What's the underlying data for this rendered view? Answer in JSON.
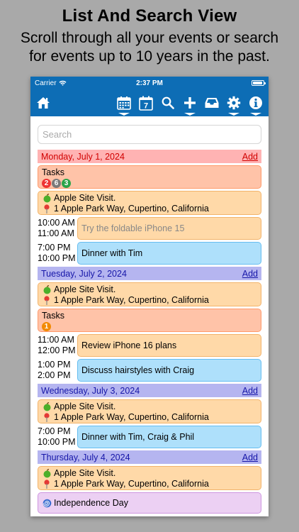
{
  "promo": {
    "title": "List And Search View",
    "subtitle_line1": "Scroll through all your events or search",
    "subtitle_line2": "for events up to 10 years in the past."
  },
  "statusbar": {
    "carrier": "Carrier",
    "time": "2:37 PM"
  },
  "toolbar": {
    "icons": [
      "home-icon",
      "calendar-month-icon",
      "calendar-week-icon",
      "search-icon",
      "add-event-icon",
      "inbox-icon",
      "settings-icon",
      "info-icon"
    ],
    "week_number": "7",
    "color": "#0d6db5"
  },
  "search": {
    "placeholder": "Search",
    "value": ""
  },
  "days": [
    {
      "header": "Monday, July 1, 2024",
      "add": "Add",
      "tasks_label": "Tasks",
      "badges": [
        "2",
        "6",
        "3"
      ],
      "site_title": "Apple Site Visit.",
      "site_address": "1 Apple Park Way, Cupertino, California",
      "events": [
        {
          "start": "10:00 AM",
          "end": "11:00 AM",
          "title": "Try the foldable iPhone 15"
        },
        {
          "start": "7:00 PM",
          "end": "10:00 PM",
          "title": "Dinner with Tim"
        }
      ]
    },
    {
      "header": "Tuesday, July 2, 2024",
      "add": "Add",
      "site_title": "Apple Site Visit.",
      "site_address": "1 Apple Park Way, Cupertino, California",
      "tasks_label": "Tasks",
      "badges": [
        "1"
      ],
      "events": [
        {
          "start": "11:00 AM",
          "end": "12:00 PM",
          "title": "Review iPhone 16 plans"
        },
        {
          "start": "1:00 PM",
          "end": "2:00 PM",
          "title": "Discuss hairstyles with Craig"
        }
      ]
    },
    {
      "header": "Wednesday, July 3, 2024",
      "add": "Add",
      "site_title": "Apple Site Visit.",
      "site_address": "1 Apple Park Way, Cupertino, California",
      "events": [
        {
          "start": "7:00 PM",
          "end": "10:00 PM",
          "title": "Dinner with Tim, Craig & Phil"
        }
      ]
    },
    {
      "header": "Thursday, July 4, 2024",
      "add": "Add",
      "site_title": "Apple Site Visit.",
      "site_address": "1 Apple Park Way, Cupertino, California",
      "holiday": "Independence Day"
    }
  ],
  "colors": {
    "header_red": "#ffb3b3",
    "header_blue": "#b5b5f0",
    "tasks": "#ffc3a8",
    "site": "#ffd9a8",
    "event_blue": "#aee0fb",
    "holiday": "#ecd0f3"
  }
}
